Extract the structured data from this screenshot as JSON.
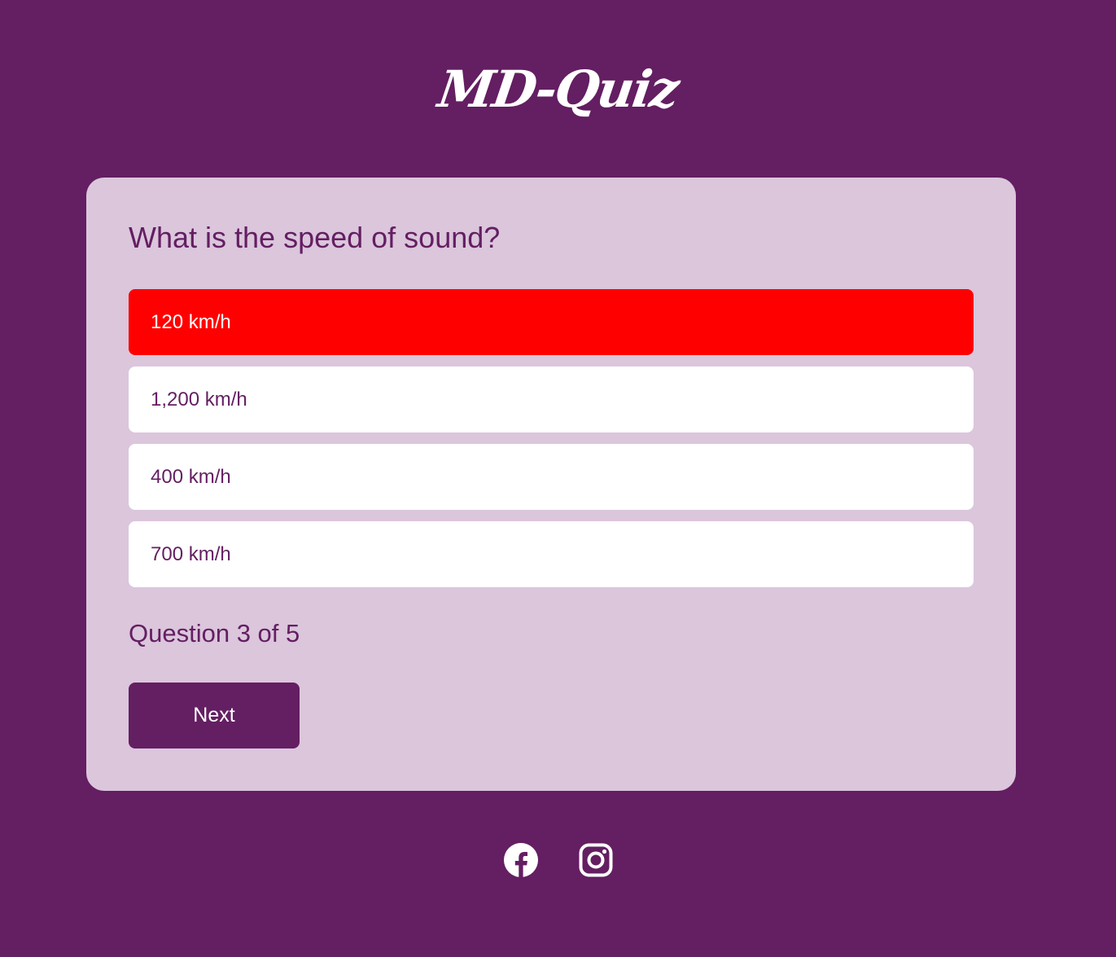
{
  "header": {
    "logo_text": "MD-Quiz"
  },
  "quiz": {
    "question": "What is the speed of sound?",
    "answers": [
      {
        "label": "120 km/h",
        "state": "incorrect-selected"
      },
      {
        "label": "1,200 km/h",
        "state": "default"
      },
      {
        "label": "400 km/h",
        "state": "default"
      },
      {
        "label": "700 km/h",
        "state": "default"
      }
    ],
    "progress_text": "Question 3 of 5",
    "next_label": "Next"
  },
  "footer": {
    "social_icons": [
      "facebook-icon",
      "instagram-icon"
    ]
  },
  "colors": {
    "background": "#641e62",
    "card": "#dbc6dc",
    "incorrect": "#ff0000",
    "answer_default": "#ffffff"
  }
}
